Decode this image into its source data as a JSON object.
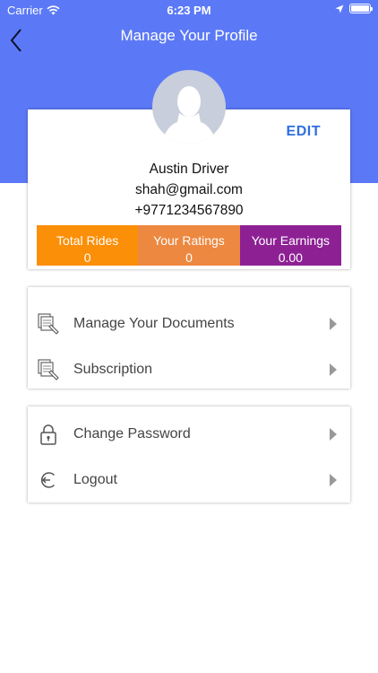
{
  "status_bar": {
    "carrier": "Carrier",
    "time": "6:23 PM"
  },
  "nav": {
    "title": "Manage Your Profile",
    "back_icon": "chevron-left-icon"
  },
  "profile": {
    "edit_label": "EDIT",
    "name": "Austin Driver",
    "email": "shah@gmail.com",
    "phone": "+9771234567890"
  },
  "stats": [
    {
      "label": "Total Rides",
      "value": "0",
      "color": "#fb8f08"
    },
    {
      "label": "Your Ratings",
      "value": "0",
      "color": "#ed8840"
    },
    {
      "label": "Your Earnings",
      "value": "0.00",
      "color": "#8d2194"
    }
  ],
  "menu_group_1": [
    {
      "label": "Manage Your Documents",
      "icon": "documents-icon"
    },
    {
      "label": "Subscription",
      "icon": "subscription-icon"
    }
  ],
  "menu_group_2": [
    {
      "label": "Change Password",
      "icon": "lock-icon"
    },
    {
      "label": "Logout",
      "icon": "logout-icon"
    }
  ],
  "colors": {
    "header": "#5b79f6",
    "edit": "#2f6fe0"
  }
}
